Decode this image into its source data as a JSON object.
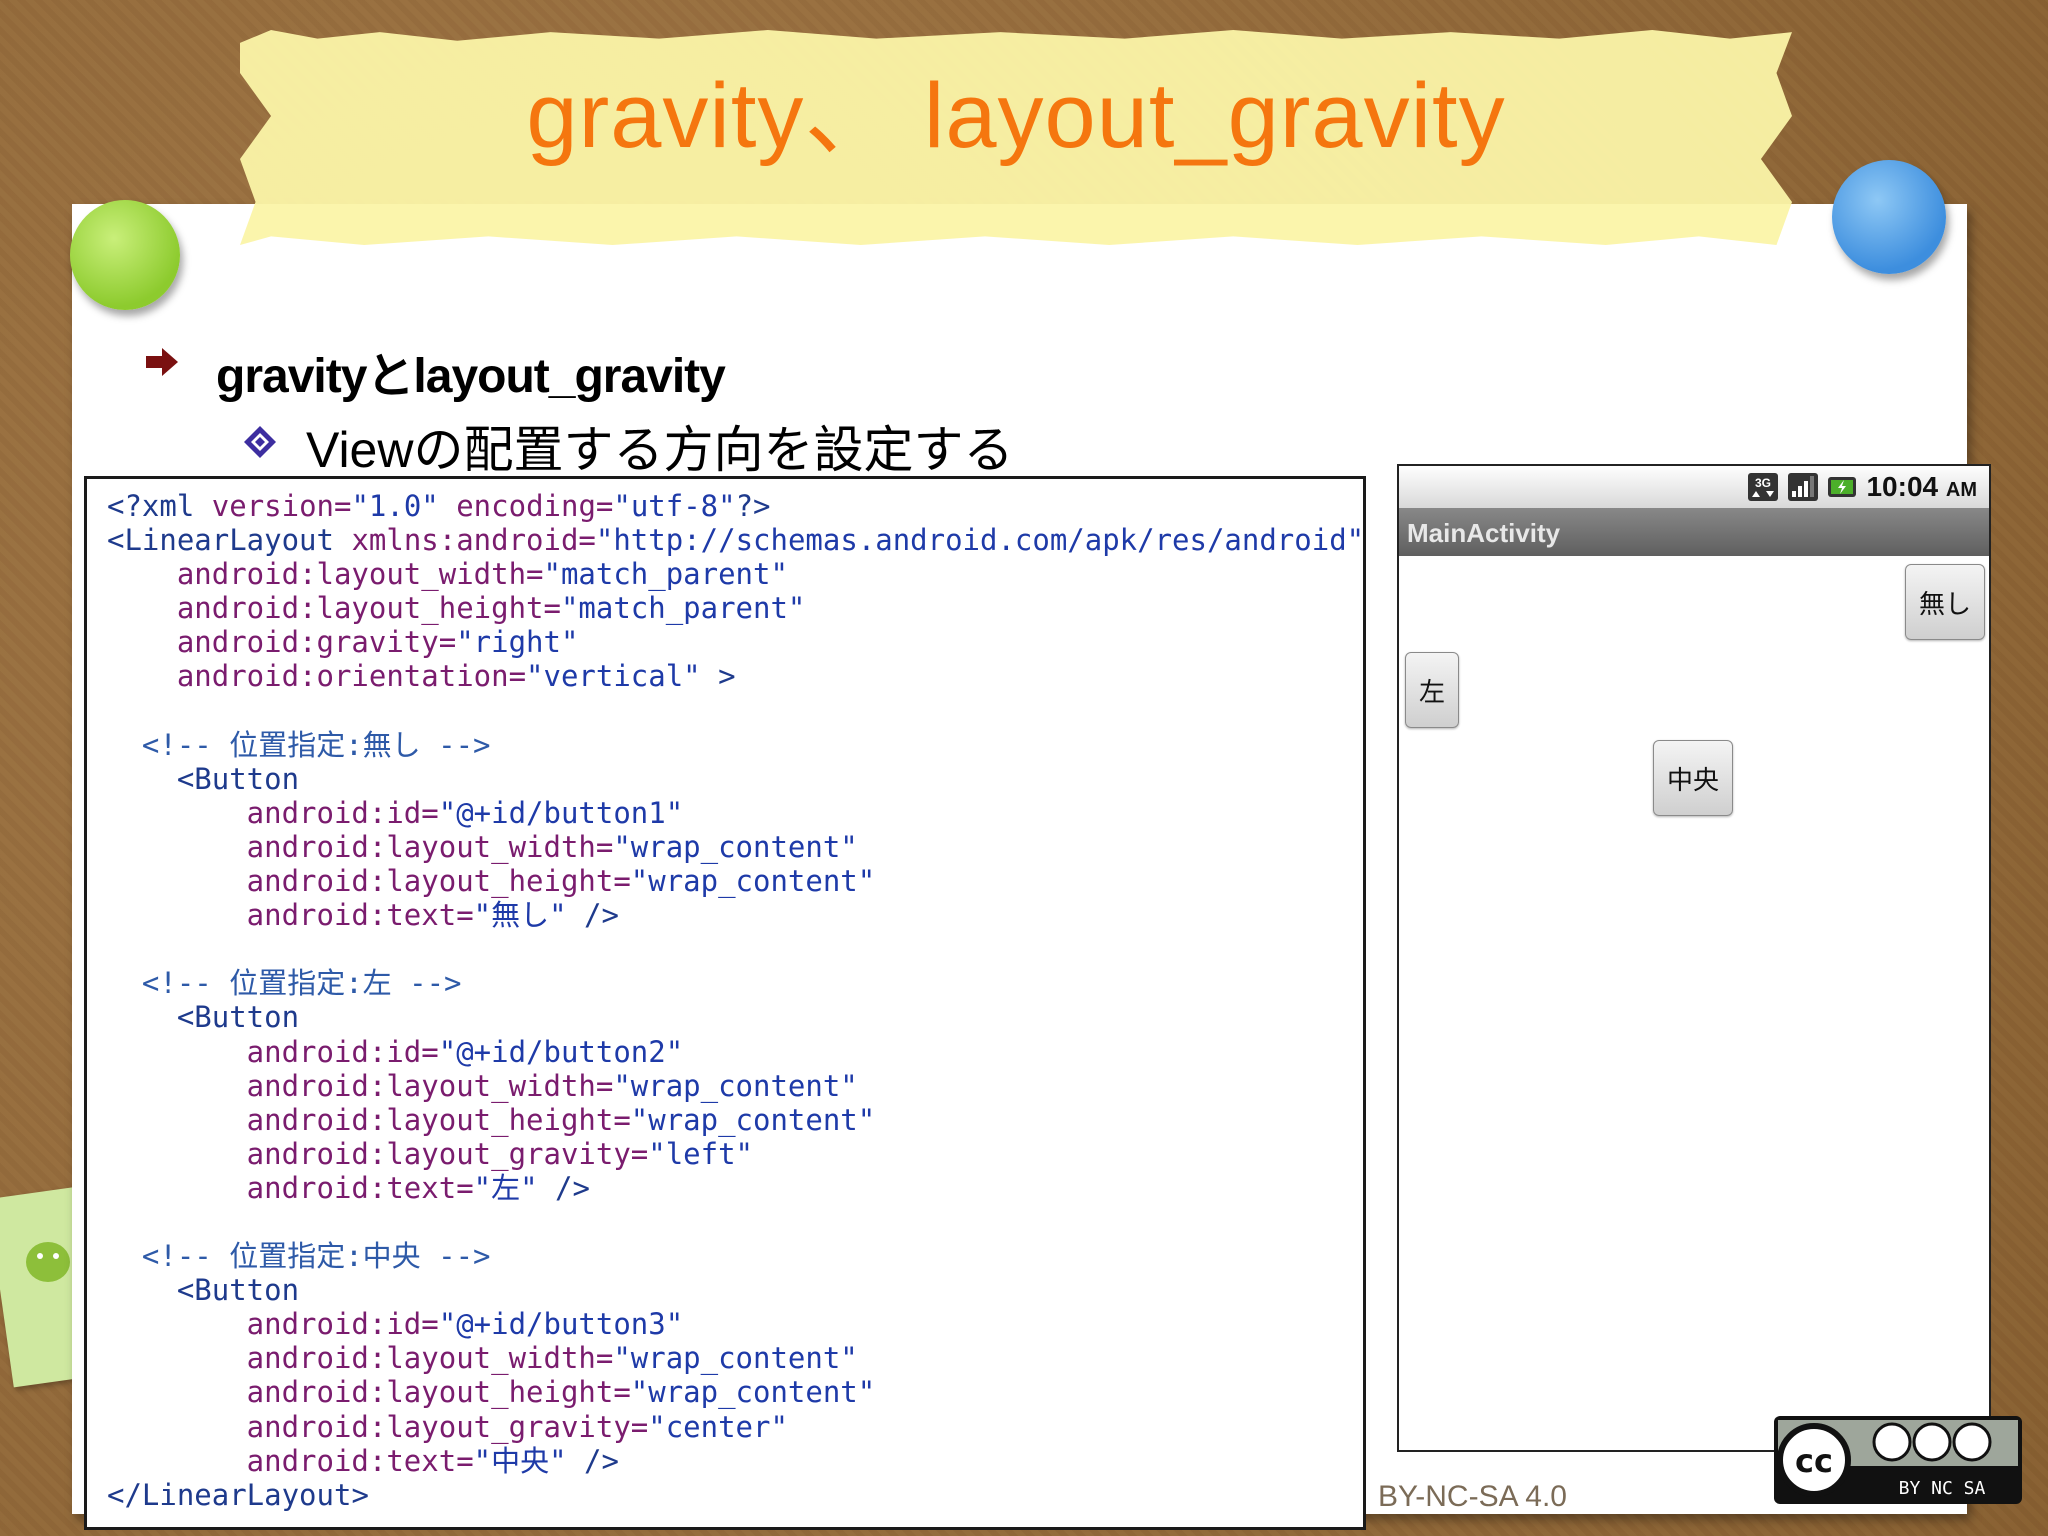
{
  "slide": {
    "title": "gravity、 layout_gravity",
    "bullet_main": "gravityとlayout_gravity",
    "bullet_sub": "Viewの配置する方向を設定する",
    "license": "BY-NC-SA 4.0"
  },
  "code_lines": [
    "<?xml version=\"1.0\" encoding=\"utf-8\"?>",
    "<LinearLayout xmlns:android=\"http://schemas.android.com/apk/res/android\"",
    "    android:layout_width=\"match_parent\"",
    "    android:layout_height=\"match_parent\"",
    "    android:gravity=\"right\"",
    "    android:orientation=\"vertical\" >",
    "",
    "  <!-- 位置指定:無し -->",
    "    <Button",
    "        android:id=\"@+id/button1\"",
    "        android:layout_width=\"wrap_content\"",
    "        android:layout_height=\"wrap_content\"",
    "        android:text=\"無し\" />",
    "",
    "  <!-- 位置指定:左 -->",
    "    <Button",
    "        android:id=\"@+id/button2\"",
    "        android:layout_width=\"wrap_content\"",
    "        android:layout_height=\"wrap_content\"",
    "        android:layout_gravity=\"left\"",
    "        android:text=\"左\" />",
    "",
    "  <!-- 位置指定:中央 -->",
    "    <Button",
    "        android:id=\"@+id/button3\"",
    "        android:layout_width=\"wrap_content\"",
    "        android:layout_height=\"wrap_content\"",
    "        android:layout_gravity=\"center\"",
    "        android:text=\"中央\" />",
    "</LinearLayout>"
  ],
  "phone": {
    "clock": "10:04",
    "clock_suffix": "AM",
    "app_title": "MainActivity",
    "buttons": {
      "none": "無し",
      "left": "左",
      "center": "中央"
    }
  },
  "colors": {
    "title": "#f5760f",
    "tape": "#fbf4a8",
    "code_attr": "#7a1c6e",
    "code_value": "#1e3aa8"
  }
}
